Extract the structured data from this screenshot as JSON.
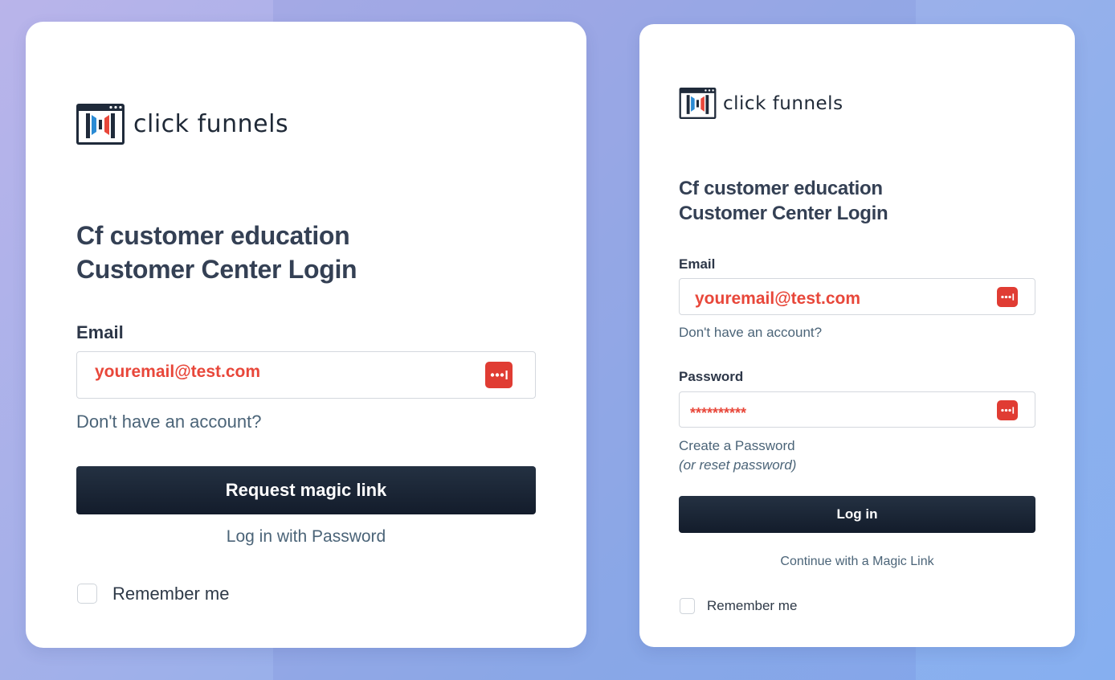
{
  "colors": {
    "accent_red": "#e8473a",
    "button_dark": "#1a2433",
    "logo_blue": "#2b8bd4"
  },
  "left_form": {
    "logo": {
      "icon": "click-funnels-logo-icon",
      "text": "click funnels"
    },
    "title_line1": "Cf customer education",
    "title_line2": "Customer Center Login",
    "email_label": "Email",
    "email_value": "youremail@test.com",
    "password_manager_icon": "password-manager-icon",
    "no_account_link": "Don't have an account?",
    "submit_button": "Request magic link",
    "alt_login_link": "Log in with Password",
    "remember_label": "Remember me"
  },
  "right_form": {
    "logo": {
      "icon": "click-funnels-logo-icon",
      "text": "click funnels"
    },
    "title_line1": "Cf customer education",
    "title_line2": "Customer Center Login",
    "email_label": "Email",
    "email_value": "youremail@test.com",
    "no_account_link": "Don't have an account?",
    "password_label": "Password",
    "password_value": "**********",
    "password_manager_icon": "password-manager-icon",
    "create_password_link": "Create a Password",
    "reset_note": "(or reset password)",
    "submit_button": "Log in",
    "alt_login_link": "Continue with a Magic Link",
    "remember_label": "Remember me"
  }
}
